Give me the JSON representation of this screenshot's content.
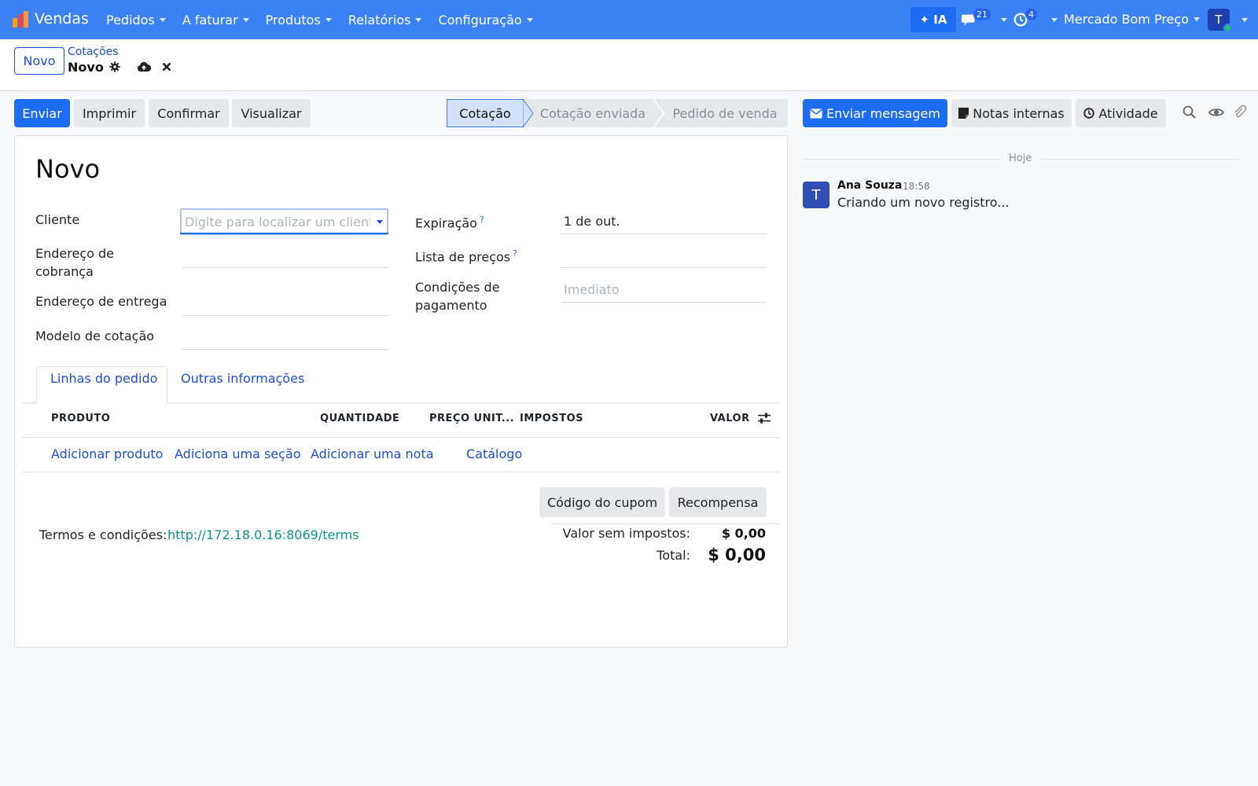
{
  "navbar": {
    "app_name": "Vendas",
    "menu": [
      "Pedidos",
      "A faturar",
      "Produtos",
      "Relatórios",
      "Configuração"
    ],
    "ia_label": "✦ IA",
    "messages_badge": "21",
    "activities_badge": "4",
    "company": "Mercado Bom Preço",
    "user_initial": "T",
    "brand_color": "#3b82f6"
  },
  "control_panel": {
    "new_button": "Novo",
    "breadcrumb_parent": "Cotações",
    "breadcrumb_current": "Novo"
  },
  "actions": {
    "send": "Enviar",
    "print": "Imprimir",
    "confirm": "Confirmar",
    "preview": "Visualizar"
  },
  "statusbar": {
    "steps": [
      "Cotação",
      "Cotação enviada",
      "Pedido de venda"
    ],
    "active": "Cotação"
  },
  "chatter": {
    "send_message": "Enviar mensagem",
    "log_note": "Notas internas",
    "activity": "Atividade",
    "date_separator": "Hoje",
    "messages": [
      {
        "author": "Ana Souza",
        "time": "18:58",
        "body": "Criando um novo registro...",
        "initial": "T"
      }
    ]
  },
  "form": {
    "title": "Novo",
    "fields": {
      "customer_label": "Cliente",
      "customer_placeholder": "Digite para localizar um cliente...",
      "invoice_address_label": "Endereço de cobrança",
      "delivery_address_label": "Endereço de entrega",
      "quotation_template_label": "Modelo de cotação",
      "expiration_label": "Expiração",
      "expiration_value": "1 de out.",
      "pricelist_label": "Lista de preços",
      "payment_terms_label": "Condições de pagamento",
      "payment_terms_placeholder": "Imediato",
      "help_mark": "?"
    },
    "tabs": [
      "Linhas do pedido",
      "Outras informações"
    ],
    "table": {
      "columns": [
        "PRODUTO",
        "QUANTIDADE",
        "PREÇO UNIT...",
        "IMPOSTOS",
        "VALOR"
      ],
      "add_links": [
        "Adicionar produto",
        "Adiciona uma seção",
        "Adicionar uma nota",
        "Catálogo"
      ]
    },
    "coupon_button": "Código do cupom",
    "reward_button": "Recompensa",
    "terms_label": "Termos e condições:",
    "terms_link": "http://172.18.0.16:8069/terms",
    "totals": {
      "untaxed_label": "Valor sem impostos:",
      "untaxed_value": "$ 0,00",
      "total_label": "Total:",
      "total_value": "$ 0,00"
    }
  }
}
